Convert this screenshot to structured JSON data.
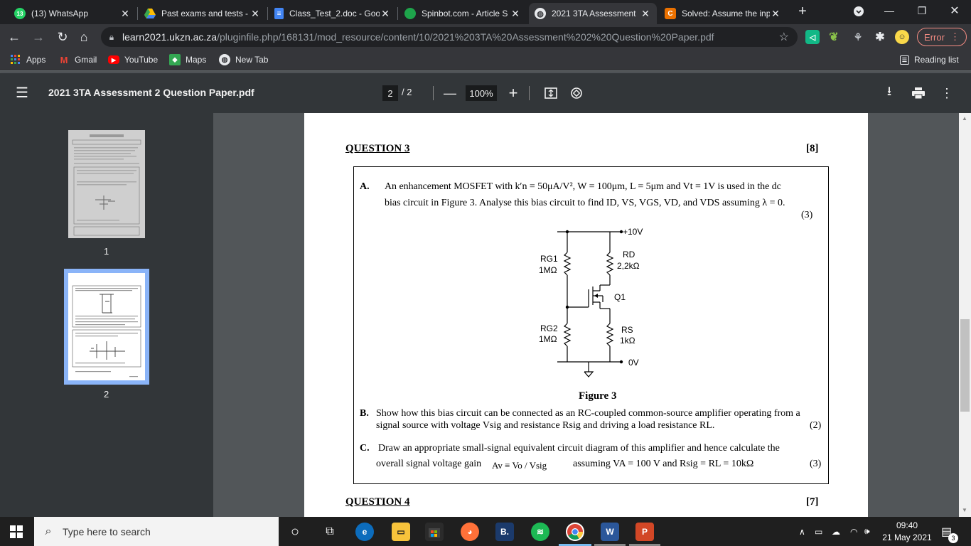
{
  "tabs": [
    {
      "title": "(13) WhatsApp",
      "icon": "whatsapp-icon",
      "badge": "13"
    },
    {
      "title": "Past exams and tests -",
      "icon": "google-drive-icon"
    },
    {
      "title": "Class_Test_2.doc - Goo",
      "icon": "google-docs-icon"
    },
    {
      "title": "Spinbot.com - Article S",
      "icon": "spinbot-icon"
    },
    {
      "title": "2021 3TA Assessment",
      "icon": "globe-icon"
    },
    {
      "title": "Solved: Assume the inp",
      "icon": "chegg-icon"
    }
  ],
  "url": {
    "host": "learn2021.ukzn.ac.za",
    "path": "/pluginfile.php/168131/mod_resource/content/10/2021%203TA%20Assessment%202%20Question%20Paper.pdf"
  },
  "error_label": "Error",
  "bookmarks": {
    "apps": "Apps",
    "gmail": "Gmail",
    "youtube": "YouTube",
    "maps": "Maps",
    "newtab": "New Tab",
    "reading_list": "Reading list"
  },
  "pdf": {
    "title": "2021 3TA Assessment 2 Question Paper.pdf",
    "current_page": "2",
    "total_pages": "/ 2",
    "zoom": "100%",
    "thumb_labels": [
      "1",
      "2"
    ]
  },
  "doc": {
    "q3_title": "QUESTION 3",
    "q3_marks": "[8]",
    "partA_label": "A.",
    "partA_text1": "An enhancement MOSFET with k′n = 50μA/V², W = 100μm, L = 5μm and Vt = 1V is used in the dc",
    "partA_text2": "bias circuit in Figure 3. Analyse this bias circuit to find ID, VS, VGS, VD, and VDS assuming λ = 0.",
    "partA_marks": "(3)",
    "figure_caption": "Figure 3",
    "circuit": {
      "vdd": "+10V",
      "rg1_name": "RG1",
      "rg1_val": "1MΩ",
      "rd_name": "RD",
      "rd_val": "2,2kΩ",
      "q1": "Q1",
      "rg2_name": "RG2",
      "rg2_val": "1MΩ",
      "rs_name": "RS",
      "rs_val": "1kΩ",
      "gnd": "0V"
    },
    "partB_label": "B.",
    "partB_text1": "Show how this bias circuit can be connected as an RC-coupled common-source amplifier operating from a",
    "partB_text2": "signal source with voltage Vsig and resistance Rsig and driving a load resistance RL.",
    "partB_marks": "(2)",
    "partC_label": "C.",
    "partC_text1": "Draw an appropriate small-signal equivalent circuit diagram of this amplifier and hence calculate the",
    "partC_text2a": "overall signal voltage gain",
    "partC_formula": "Av ≡ Vo / Vsig",
    "partC_text2b": "assuming VA = 100 V and Rsig = RL = 10kΩ",
    "partC_marks": "(3)",
    "q4_title": "QUESTION 4",
    "q4_marks": "[7]"
  },
  "taskbar": {
    "search_placeholder": "Type here to search",
    "time": "09:40",
    "date": "21 May 2021",
    "notification_count": "3"
  }
}
